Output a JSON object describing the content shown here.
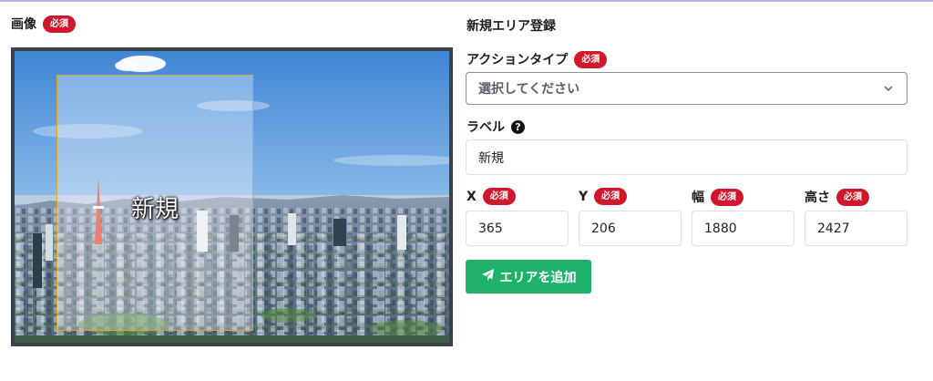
{
  "image_section": {
    "label": "画像",
    "required_badge": "必須",
    "area_label": "新規"
  },
  "form": {
    "title": "新規エリア登録",
    "action_type": {
      "label": "アクションタイプ",
      "required_badge": "必須",
      "selected": "選択してください",
      "icon": "chevron-down-icon"
    },
    "label_field": {
      "label": "ラベル",
      "help_icon": "?",
      "value": "新規"
    },
    "x": {
      "label": "X",
      "required_badge": "必須",
      "value": "365"
    },
    "y": {
      "label": "Y",
      "required_badge": "必須",
      "value": "206"
    },
    "width": {
      "label": "幅",
      "required_badge": "必須",
      "value": "1880"
    },
    "height": {
      "label": "高さ",
      "required_badge": "必須",
      "value": "2427"
    },
    "submit_button": {
      "label": "エリアを追加",
      "icon": "send-icon"
    }
  },
  "colors": {
    "required_badge": "#d0182c",
    "submit_button": "#1fb26b",
    "area_border": "#e3a526"
  }
}
